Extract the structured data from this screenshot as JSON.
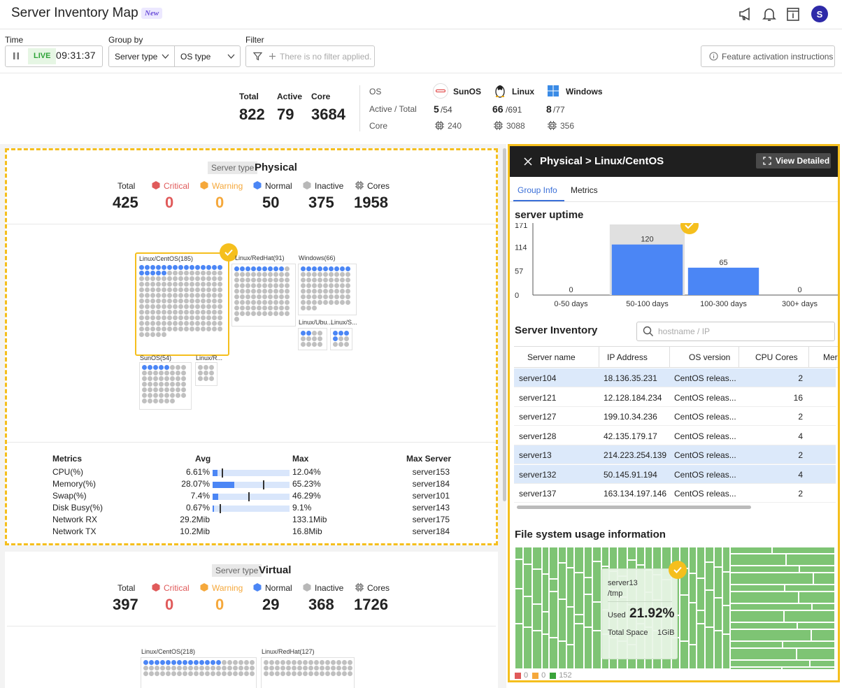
{
  "header": {
    "title": "Server Inventory Map",
    "badge": "New",
    "avatar_initial": "S"
  },
  "toolbar": {
    "time_label": "Time",
    "live_label": "LIVE",
    "clock": "09:31:37",
    "group_by_label": "Group by",
    "group_by_1": "Server type",
    "group_by_2": "OS type",
    "filter_label": "Filter",
    "filter_placeholder": "There is no filter applied.",
    "feature_btn": "Feature activation instructions"
  },
  "summary": {
    "total_label": "Total",
    "total": "822",
    "active_label": "Active",
    "active": "79",
    "core_label": "Core",
    "core": "3684",
    "os_label": "OS",
    "active_total_label": "Active / Total",
    "core_row_label": "Core",
    "os": [
      {
        "name": "SunOS",
        "active": "5",
        "total": "/54",
        "core": "240"
      },
      {
        "name": "Linux",
        "active": "66",
        "total": "/691",
        "core": "3088"
      },
      {
        "name": "Windows",
        "active": "8",
        "total": "/77",
        "core": "356"
      }
    ]
  },
  "physical": {
    "type_label": "Server type",
    "type": "Physical",
    "stats": {
      "total_label": "Total",
      "total": "425",
      "critical_label": "Critical",
      "critical": "0",
      "warning_label": "Warning",
      "warning": "0",
      "normal_label": "Normal",
      "normal": "50",
      "inactive_label": "Inactive",
      "inactive": "375",
      "cores_label": "Cores",
      "cores": "1958"
    },
    "groups": {
      "centos": "Linux/CentOS(185)",
      "redhat": "Linux/RedHat(91)",
      "windows": "Windows(66)",
      "ubuntu": "Linux/Ubu...",
      "linuxs": "Linux/S...",
      "sunos": "SunOS(54)",
      "linuxr": "Linux/R..."
    },
    "metrics": {
      "h_metrics": "Metrics",
      "h_avg": "Avg",
      "h_max": "Max",
      "h_server": "Max Server",
      "rows": [
        {
          "name": "CPU(%)",
          "avg": "6.61%",
          "max": "12.04%",
          "server": "server153",
          "avg_pct": 6.61,
          "max_pct": 12.04
        },
        {
          "name": "Memory(%)",
          "avg": "28.07%",
          "max": "65.23%",
          "server": "server184",
          "avg_pct": 28.07,
          "max_pct": 65.23
        },
        {
          "name": "Swap(%)",
          "avg": "7.4%",
          "max": "46.29%",
          "server": "server101",
          "avg_pct": 7.4,
          "max_pct": 46.29
        },
        {
          "name": "Disk Busy(%)",
          "avg": "0.67%",
          "max": "9.1%",
          "server": "server143",
          "avg_pct": 0.67,
          "max_pct": 9.1
        },
        {
          "name": "Network RX",
          "avg": "29.2Mib",
          "max": "133.1Mib",
          "server": "server175"
        },
        {
          "name": "Network TX",
          "avg": "10.2Mib",
          "max": "16.8Mib",
          "server": "server184"
        }
      ]
    }
  },
  "virtual": {
    "type_label": "Server type",
    "type": "Virtual",
    "stats": {
      "total_label": "Total",
      "total": "397",
      "critical_label": "Critical",
      "critical": "0",
      "warning_label": "Warning",
      "warning": "0",
      "normal_label": "Normal",
      "normal": "29",
      "inactive_label": "Inactive",
      "inactive": "368",
      "cores_label": "Cores",
      "cores": "1726"
    },
    "groups": {
      "centos": "Linux/CentOS(218)",
      "redhat": "Linux/RedHat(127)"
    }
  },
  "panel": {
    "title": "Physical > Linux/CentOS",
    "view_detailed": "View Detailed",
    "tabs": [
      "Group Info",
      "Metrics"
    ],
    "uptime_title": "server uptime",
    "inventory_title": "Server Inventory",
    "search_placeholder": "hostname / IP",
    "columns": [
      "Server name",
      "IP Address",
      "OS version",
      "CPU Cores",
      "Mer"
    ],
    "rows": [
      {
        "name": "server104",
        "ip": "18.136.35.231",
        "os": "CentOS releas...",
        "cores": "2",
        "hl": true
      },
      {
        "name": "server121",
        "ip": "12.128.184.234",
        "os": "CentOS releas...",
        "cores": "16",
        "hl": false
      },
      {
        "name": "server127",
        "ip": "199.10.34.236",
        "os": "CentOS releas...",
        "cores": "2",
        "hl": false
      },
      {
        "name": "server128",
        "ip": "42.135.179.17",
        "os": "CentOS releas...",
        "cores": "4",
        "hl": false
      },
      {
        "name": "server13",
        "ip": "214.223.254.139",
        "os": "CentOS releas...",
        "cores": "2",
        "hl": true
      },
      {
        "name": "server132",
        "ip": "50.145.91.194",
        "os": "CentOS releas...",
        "cores": "4",
        "hl": true
      },
      {
        "name": "server137",
        "ip": "163.134.197.146",
        "os": "CentOS releas...",
        "cores": "2",
        "hl": false
      }
    ],
    "fs_title": "File system usage information",
    "tooltip": {
      "server": "server13",
      "path": "/tmp",
      "used_label": "Used",
      "used": "21.92%",
      "total_label": "Total Space",
      "total": "1GiB"
    },
    "legend": [
      "0",
      "0",
      "152"
    ]
  },
  "chart_data": {
    "type": "bar",
    "title": "server uptime",
    "categories": [
      "0-50 days",
      "50-100 days",
      "100-300 days",
      "300+ days"
    ],
    "values": [
      0,
      120,
      65,
      0
    ],
    "yticks": [
      "171",
      "114",
      "57",
      "0"
    ],
    "ylim": [
      0,
      171
    ],
    "colors": {
      "bar": "#4b86f5",
      "highlight": "#e0e0e0"
    }
  }
}
